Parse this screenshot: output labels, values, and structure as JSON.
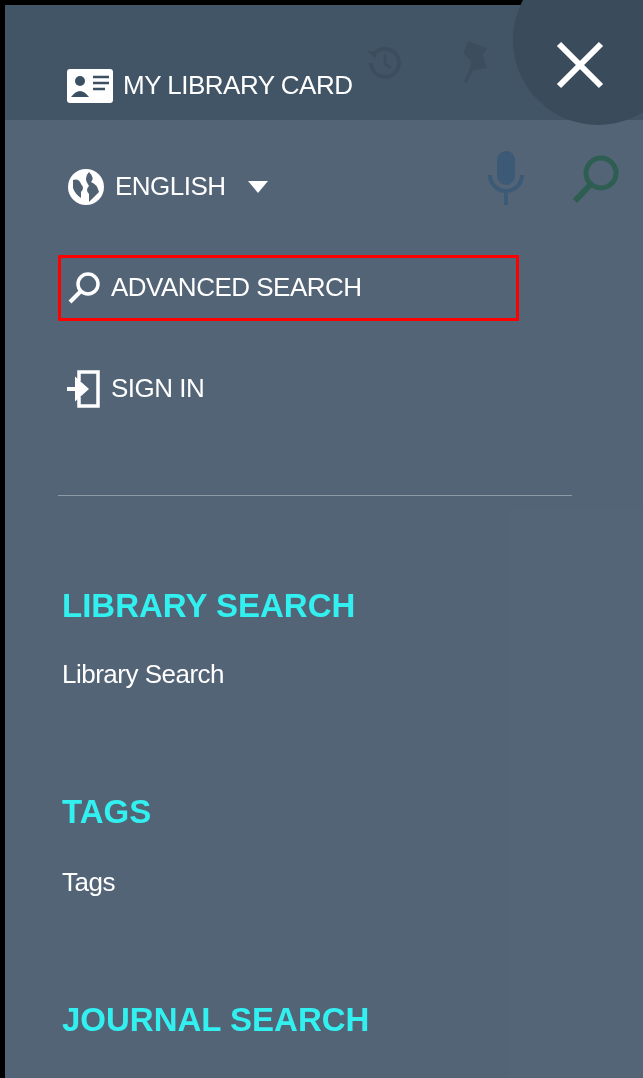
{
  "menu": {
    "items": [
      {
        "kind": "card",
        "label": "MY LIBRARY CARD",
        "highlighted": false
      },
      {
        "kind": "language",
        "label": "ENGLISH",
        "highlighted": false
      },
      {
        "kind": "search",
        "label": "ADVANCED SEARCH",
        "highlighted": true
      },
      {
        "kind": "signin",
        "label": "SIGN IN",
        "highlighted": false
      }
    ],
    "sections": [
      {
        "title": "LIBRARY SEARCH",
        "link": "Library Search"
      },
      {
        "title": "TAGS",
        "link": "Tags"
      },
      {
        "title": "JOURNAL SEARCH"
      }
    ]
  }
}
